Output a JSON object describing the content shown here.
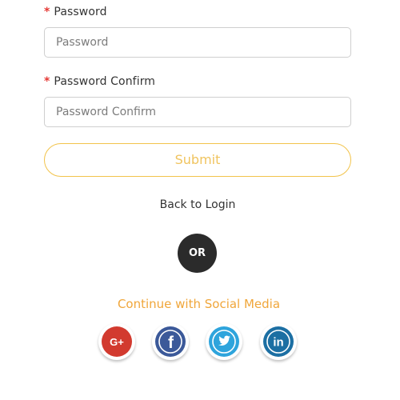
{
  "form": {
    "password": {
      "required_mark": "*",
      "label": "Password",
      "placeholder": "Password",
      "value": ""
    },
    "password_confirm": {
      "required_mark": "*",
      "label": "Password Confirm",
      "placeholder": "Password Confirm",
      "value": ""
    },
    "submit_label": "Submit"
  },
  "links": {
    "back_to_login": "Back to Login"
  },
  "divider": {
    "or_label": "OR"
  },
  "social": {
    "title": "Continue with Social Media",
    "buttons": [
      {
        "name": "google-plus",
        "icon": "google-plus-icon",
        "glyph": "G+",
        "color": "#d23a2f"
      },
      {
        "name": "facebook",
        "icon": "facebook-icon",
        "glyph": "f",
        "color": "#3b5999"
      },
      {
        "name": "twitter",
        "icon": "twitter-icon",
        "color": "#2ea4dc"
      },
      {
        "name": "linkedin",
        "icon": "linkedin-icon",
        "glyph": "in",
        "color": "#1c6fa3"
      }
    ]
  },
  "colors": {
    "required": "#e53935",
    "accent": "#f0a63a",
    "submit_border": "#f2c34a",
    "or_badge": "#2b2b2b"
  }
}
